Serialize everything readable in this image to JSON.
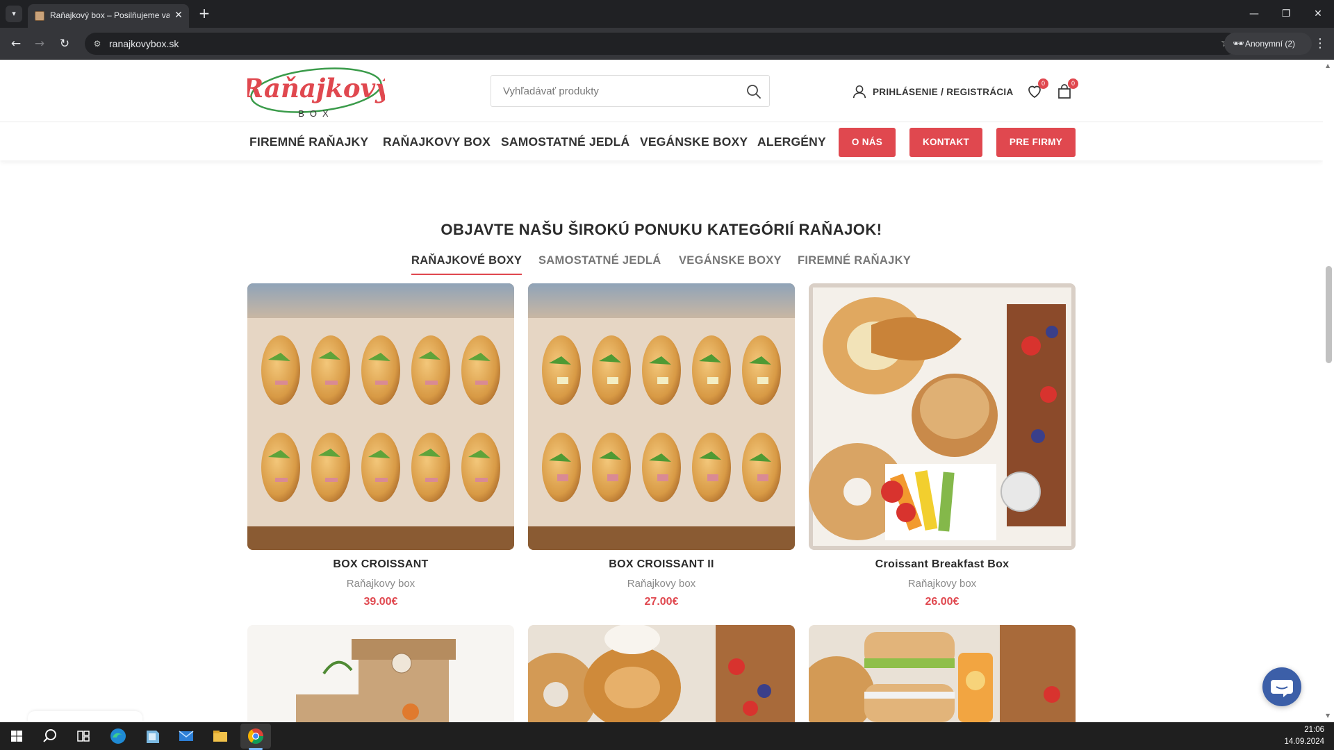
{
  "browser": {
    "tab_title": "Raňajkový box – Posilňujeme va",
    "url": "ranajkovybox.sk",
    "profile": "Anonymní (2)",
    "window_controls": [
      "minimize-icon",
      "restore-icon",
      "close-icon"
    ]
  },
  "header": {
    "logo_text": "Raňajkový",
    "logo_subtext": "BOX",
    "search_placeholder": "Vyhľadávať produkty",
    "login_label": "PRIHLÁSENIE / REGISTRÁCIA",
    "wishlist_count": "0",
    "cart_count": "0"
  },
  "nav": {
    "links": [
      "FIREMNÉ RAŇAJKY",
      "RAŇAJKOVY BOX",
      "SAMOSTATNÉ JEDLÁ",
      "VEGÁNSKE BOXY",
      "ALERGÉNY"
    ],
    "buttons": [
      "O NÁS",
      "KONTAKT",
      "PRE FIRMY"
    ]
  },
  "section": {
    "title": "OBJAVTE NAŠU ŠIROKÚ PONUKU KATEGÓRIÍ RAŇAJOK!",
    "tabs": [
      "RAŇAJKOVÉ BOXY",
      "SAMOSTATNÉ JEDLÁ",
      "VEGÁNSKE BOXY",
      "FIREMNÉ RAŇAJKY"
    ],
    "active_tab": "RAŇAJKOVÉ BOXY"
  },
  "products": [
    {
      "name": "BOX CROISSANT",
      "category": "Raňajkovy box",
      "price": "39.00€"
    },
    {
      "name": "BOX CROISSANT II",
      "category": "Raňajkovy box",
      "price": "27.00€"
    },
    {
      "name": "Croissant Breakfast Box",
      "category": "Raňajkovy box",
      "price": "26.00€"
    }
  ],
  "taskbar": {
    "time": "21:06",
    "date": "14.09.2024",
    "icons": [
      "windows-start-icon",
      "search-icon",
      "task-view-icon",
      "edge-icon",
      "app-icon",
      "mail-icon",
      "file-explorer-icon",
      "chrome-icon"
    ]
  },
  "colors": {
    "accent": "#e0484f",
    "text_dark": "#2b2b2b",
    "chrome_dark": "#202124"
  }
}
